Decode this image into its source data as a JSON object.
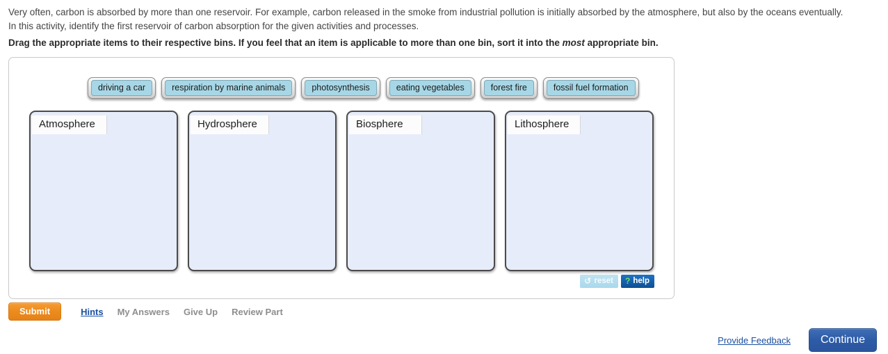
{
  "intro": {
    "paragraph": "Very often, carbon is absorbed by more than one reservoir. For example, carbon released in the smoke from industrial pollution is initially absorbed by the atmosphere, but also by the oceans eventually. In this activity, identify the first reservoir of carbon absorption for the given activities and processes.",
    "instruction_before": "Drag the appropriate items to their respective bins. If you feel that an item is applicable to more than one bin, sort it into the ",
    "instruction_emphasis": "most",
    "instruction_after": " appropriate bin."
  },
  "activity": {
    "items": [
      {
        "label": "driving a car"
      },
      {
        "label": "respiration by marine animals"
      },
      {
        "label": "photosynthesis"
      },
      {
        "label": "eating vegetables"
      },
      {
        "label": "forest fire"
      },
      {
        "label": "fossil fuel formation"
      }
    ],
    "bins": [
      {
        "label": "Atmosphere",
        "contents": []
      },
      {
        "label": "Hydrosphere",
        "contents": []
      },
      {
        "label": "Biosphere",
        "contents": []
      },
      {
        "label": "Lithosphere",
        "contents": []
      }
    ],
    "tools": {
      "reset_label": "reset",
      "reset_icon": "circular-arrow-icon",
      "reset_glyph": "↻",
      "help_label": "help",
      "help_icon": "question-mark-icon",
      "help_glyph": "?"
    }
  },
  "actions": {
    "submit_label": "Submit",
    "hints_label": "Hints",
    "my_answers_label": "My Answers",
    "give_up_label": "Give Up",
    "review_part_label": "Review Part"
  },
  "footer": {
    "feedback_label": "Provide Feedback",
    "continue_label": "Continue"
  },
  "colors": {
    "chip_fill": "#a7d7e6",
    "bin_fill": "#e7ecfa",
    "bin_border": "#4b4b4b",
    "submit_orange": "#ec8b1c",
    "continue_blue": "#2d5ba6",
    "link_blue": "#1a4fa0",
    "help_blue": "#0d4f93",
    "reset_blue": "#a9d8ec"
  }
}
